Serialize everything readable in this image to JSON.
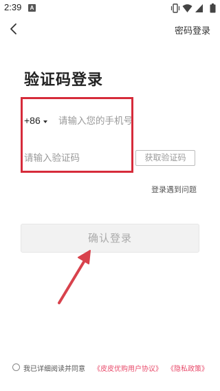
{
  "status_bar": {
    "time": "2:39",
    "notification_badge": "A"
  },
  "header": {
    "back_icon": "chevron-left-icon",
    "password_login_label": "密码登录"
  },
  "title": "验证码登录",
  "phone": {
    "country_code": "+86",
    "placeholder": "请输入您的手机号"
  },
  "code": {
    "placeholder": "请输入验证码",
    "get_code_label": "获取验证码"
  },
  "trouble_label": "登录遇到问题",
  "confirm_label": "确认登录",
  "agreement": {
    "text": "我已详细阅读并同意",
    "user_agreement": "《皮皮优购用户协议》",
    "privacy_policy": "《隐私政策》"
  },
  "colors": {
    "highlight": "#d62b3a",
    "link": "#e84a6a"
  }
}
